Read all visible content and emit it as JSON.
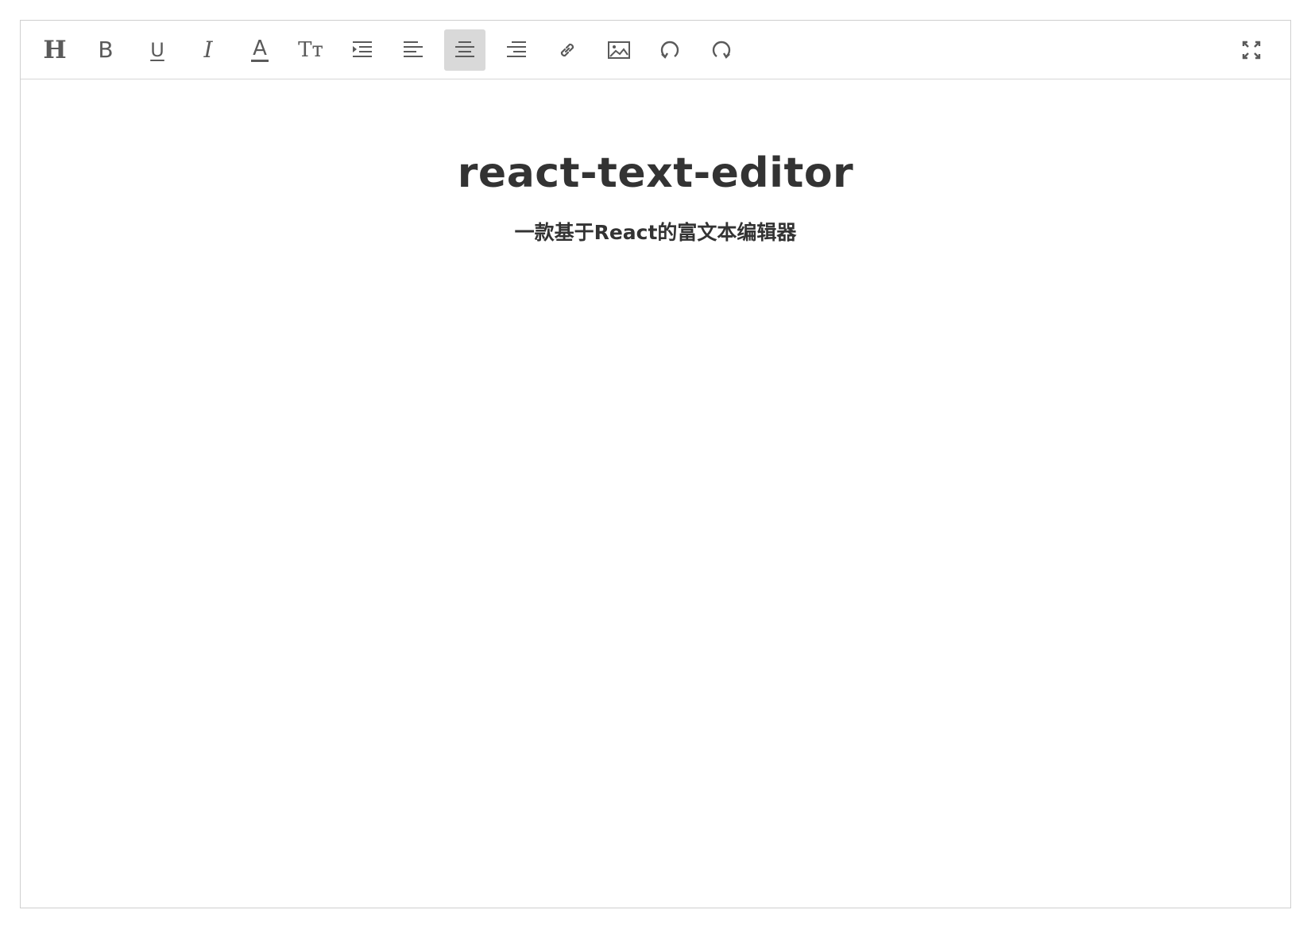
{
  "toolbar": {
    "items": [
      {
        "name": "heading",
        "icon": "heading-icon",
        "glyph": "H"
      },
      {
        "name": "bold",
        "icon": "bold-icon",
        "glyph": "B"
      },
      {
        "name": "underline",
        "icon": "underline-icon",
        "glyph": "U"
      },
      {
        "name": "italic",
        "icon": "italic-icon",
        "glyph": "I"
      },
      {
        "name": "font-color",
        "icon": "font-color-icon",
        "glyph": "A"
      },
      {
        "name": "font-size",
        "icon": "font-size-icon",
        "glyph": "Tт"
      },
      {
        "name": "indent",
        "icon": "indent-icon"
      },
      {
        "name": "align-left",
        "icon": "align-left-icon"
      },
      {
        "name": "align-center",
        "icon": "align-center-icon",
        "active": true
      },
      {
        "name": "align-right",
        "icon": "align-right-icon"
      },
      {
        "name": "link",
        "icon": "link-icon"
      },
      {
        "name": "image",
        "icon": "image-icon"
      },
      {
        "name": "undo",
        "icon": "undo-icon"
      },
      {
        "name": "redo",
        "icon": "redo-icon"
      },
      {
        "name": "fullscreen",
        "icon": "fullscreen-icon"
      }
    ]
  },
  "document": {
    "title": "react-text-editor",
    "subtitle": "一款基于React的富文本编辑器"
  },
  "colors": {
    "icon": "#5a5a5a",
    "active_bg": "#d9d9d9",
    "border": "#cfcfcf",
    "text": "#333333"
  }
}
